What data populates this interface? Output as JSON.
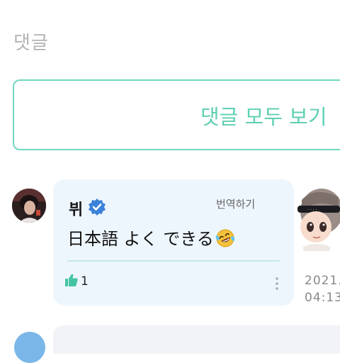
{
  "section": {
    "title": "댓글"
  },
  "view_all": {
    "label": "댓글 모두 보기"
  },
  "comment": {
    "author": "뷔",
    "translate_label": "번역하기",
    "text": "日本語 よく できる",
    "emoji": "rolling-on-floor-laughing-emoji",
    "likes": "1",
    "timestamp_line1": "2021.",
    "timestamp_line2": "04:13"
  },
  "colors": {
    "accent": "#5fcfb3",
    "bubble_bg": "#eef6fd",
    "verified": "#3b82d9"
  }
}
